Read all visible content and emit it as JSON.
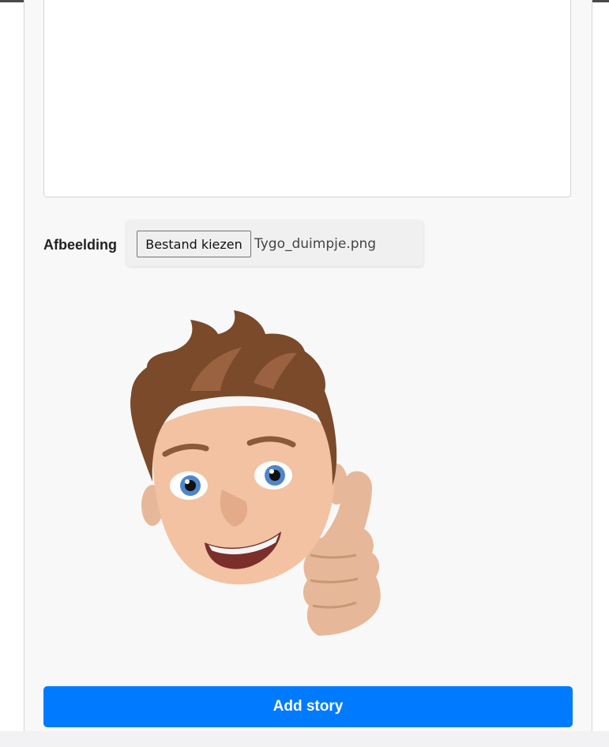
{
  "form": {
    "image_label": "Afbeelding",
    "file_button_label": "Bestand kiezen",
    "file_name": "Tygo_duimpje.png",
    "submit_label": "Add story"
  },
  "preview": {
    "icon": "memoji-thumbs-up-image"
  },
  "colors": {
    "accent": "#007bff",
    "panel_bg": "#f8f8f8"
  }
}
